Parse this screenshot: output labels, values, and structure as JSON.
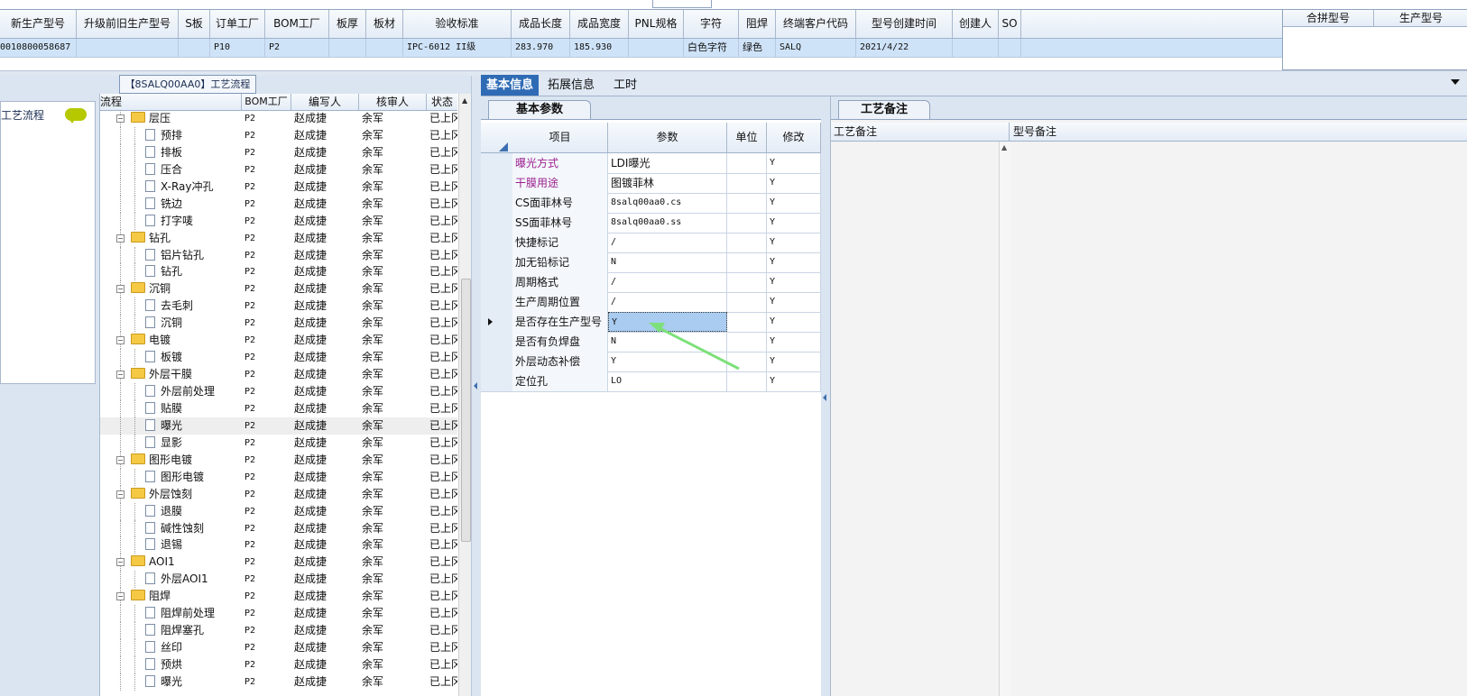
{
  "top_grid": {
    "columns": [
      "新生产型号",
      "升级前旧生产型号",
      "S板",
      "订单工厂",
      "BOM工厂",
      "板厚",
      "板材",
      "验收标准",
      "成品长度",
      "成品宽度",
      "PNL规格",
      "字符",
      "阻焊",
      "终端客户代码",
      "型号创建时间",
      "创建人",
      "SO"
    ],
    "row": {
      "新生产型号": "0010800058687",
      "订单工厂": "P10",
      "BOM工厂": "P2",
      "验收标准": "IPC-6012 II级",
      "成品长度": "283.970",
      "成品宽度": "185.930",
      "字符": "白色字符",
      "阻焊": "绿色",
      "终端客户代码": "SALQ",
      "型号创建时间": "2021/4/22"
    },
    "right_columns": [
      "合拼型号",
      "生产型号"
    ]
  },
  "left_panel": {
    "tab_title": "【8SALQ00AA0】工艺流程",
    "side_label": "工艺流程",
    "tree_columns": [
      "流程",
      "BOM工厂",
      "编写人",
      "核审人",
      "状态"
    ],
    "tree_rows": [
      {
        "level": 0,
        "name": "层压",
        "bom": "P2",
        "writer": "赵成捷",
        "reviewer": "余军",
        "status": "已上冈"
      },
      {
        "level": 1,
        "name": "预排",
        "bom": "P2",
        "writer": "赵成捷",
        "reviewer": "余军",
        "status": "已上冈"
      },
      {
        "level": 1,
        "name": "排板",
        "bom": "P2",
        "writer": "赵成捷",
        "reviewer": "余军",
        "status": "已上冈"
      },
      {
        "level": 1,
        "name": "压合",
        "bom": "P2",
        "writer": "赵成捷",
        "reviewer": "余军",
        "status": "已上冈"
      },
      {
        "level": 1,
        "name": "X-Ray冲孔",
        "bom": "P2",
        "writer": "赵成捷",
        "reviewer": "余军",
        "status": "已上冈"
      },
      {
        "level": 1,
        "name": "铣边",
        "bom": "P2",
        "writer": "赵成捷",
        "reviewer": "余军",
        "status": "已上冈"
      },
      {
        "level": 1,
        "name": "打字唛",
        "bom": "P2",
        "writer": "赵成捷",
        "reviewer": "余军",
        "status": "已上冈"
      },
      {
        "level": 0,
        "name": "钻孔",
        "bom": "P2",
        "writer": "赵成捷",
        "reviewer": "余军",
        "status": "已上冈"
      },
      {
        "level": 1,
        "name": "铝片钻孔",
        "bom": "P2",
        "writer": "赵成捷",
        "reviewer": "余军",
        "status": "已上冈"
      },
      {
        "level": 1,
        "name": "钻孔",
        "bom": "P2",
        "writer": "赵成捷",
        "reviewer": "余军",
        "status": "已上冈"
      },
      {
        "level": 0,
        "name": "沉铜",
        "bom": "P2",
        "writer": "赵成捷",
        "reviewer": "余军",
        "status": "已上冈"
      },
      {
        "level": 1,
        "name": "去毛刺",
        "bom": "P2",
        "writer": "赵成捷",
        "reviewer": "余军",
        "status": "已上冈"
      },
      {
        "level": 1,
        "name": "沉铜",
        "bom": "P2",
        "writer": "赵成捷",
        "reviewer": "余军",
        "status": "已上冈"
      },
      {
        "level": 0,
        "name": "电镀",
        "bom": "P2",
        "writer": "赵成捷",
        "reviewer": "余军",
        "status": "已上冈"
      },
      {
        "level": 1,
        "name": "板镀",
        "bom": "P2",
        "writer": "赵成捷",
        "reviewer": "余军",
        "status": "已上冈"
      },
      {
        "level": 0,
        "name": "外层干膜",
        "bom": "P2",
        "writer": "赵成捷",
        "reviewer": "余军",
        "status": "已上冈"
      },
      {
        "level": 1,
        "name": "外层前处理",
        "bom": "P2",
        "writer": "赵成捷",
        "reviewer": "余军",
        "status": "已上冈"
      },
      {
        "level": 1,
        "name": "贴膜",
        "bom": "P2",
        "writer": "赵成捷",
        "reviewer": "余军",
        "status": "已上冈"
      },
      {
        "level": 1,
        "name": "曝光",
        "bom": "P2",
        "writer": "赵成捷",
        "reviewer": "余军",
        "status": "已上冈",
        "highlight": true
      },
      {
        "level": 1,
        "name": "显影",
        "bom": "P2",
        "writer": "赵成捷",
        "reviewer": "余军",
        "status": "已上冈"
      },
      {
        "level": 0,
        "name": "图形电镀",
        "bom": "P2",
        "writer": "赵成捷",
        "reviewer": "余军",
        "status": "已上冈"
      },
      {
        "level": 1,
        "name": "图形电镀",
        "bom": "P2",
        "writer": "赵成捷",
        "reviewer": "余军",
        "status": "已上冈"
      },
      {
        "level": 0,
        "name": "外层蚀刻",
        "bom": "P2",
        "writer": "赵成捷",
        "reviewer": "余军",
        "status": "已上冈"
      },
      {
        "level": 1,
        "name": "退膜",
        "bom": "P2",
        "writer": "赵成捷",
        "reviewer": "余军",
        "status": "已上冈"
      },
      {
        "level": 1,
        "name": "碱性蚀刻",
        "bom": "P2",
        "writer": "赵成捷",
        "reviewer": "余军",
        "status": "已上冈"
      },
      {
        "level": 1,
        "name": "退锡",
        "bom": "P2",
        "writer": "赵成捷",
        "reviewer": "余军",
        "status": "已上冈"
      },
      {
        "level": 0,
        "name": "AOI1",
        "bom": "P2",
        "writer": "赵成捷",
        "reviewer": "余军",
        "status": "已上冈"
      },
      {
        "level": 1,
        "name": "外层AOI1",
        "bom": "P2",
        "writer": "赵成捷",
        "reviewer": "余军",
        "status": "已上冈"
      },
      {
        "level": 0,
        "name": "阻焊",
        "bom": "P2",
        "writer": "赵成捷",
        "reviewer": "余军",
        "status": "已上冈"
      },
      {
        "level": 1,
        "name": "阻焊前处理",
        "bom": "P2",
        "writer": "赵成捷",
        "reviewer": "余军",
        "status": "已上冈"
      },
      {
        "level": 1,
        "name": "阻焊塞孔",
        "bom": "P2",
        "writer": "赵成捷",
        "reviewer": "余军",
        "status": "已上冈"
      },
      {
        "level": 1,
        "name": "丝印",
        "bom": "P2",
        "writer": "赵成捷",
        "reviewer": "余军",
        "status": "已上冈"
      },
      {
        "level": 1,
        "name": "预烘",
        "bom": "P2",
        "writer": "赵成捷",
        "reviewer": "余军",
        "status": "已上冈"
      },
      {
        "level": 1,
        "name": "曝光",
        "bom": "P2",
        "writer": "赵成捷",
        "reviewer": "余军",
        "status": "已上冈"
      }
    ]
  },
  "main_tabs": [
    "基本信息",
    "拓展信息",
    "工时"
  ],
  "basic_params": {
    "subtab": "基本参数",
    "columns": [
      "项目",
      "参数",
      "单位",
      "修改"
    ],
    "rows": [
      {
        "item": "曝光方式",
        "value": "LDI曝光",
        "unit": "",
        "mod": "Y",
        "purple": true
      },
      {
        "item": "干膜用途",
        "value": "图镀菲林",
        "unit": "",
        "mod": "Y",
        "purple": true
      },
      {
        "item": "CS面菲林号",
        "value": "8salq00aa0.cs",
        "unit": "",
        "mod": "Y"
      },
      {
        "item": "SS面菲林号",
        "value": "8salq00aa0.ss",
        "unit": "",
        "mod": "Y"
      },
      {
        "item": "快捷标记",
        "value": "/",
        "unit": "",
        "mod": "Y"
      },
      {
        "item": "加无铅标记",
        "value": "N",
        "unit": "",
        "mod": "Y"
      },
      {
        "item": "周期格式",
        "value": "/",
        "unit": "",
        "mod": "Y"
      },
      {
        "item": "生产周期位置",
        "value": "/",
        "unit": "",
        "mod": "Y"
      },
      {
        "item": "是否存在生产型号",
        "value": "Y",
        "unit": "",
        "mod": "Y",
        "current": true
      },
      {
        "item": "是否有负焊盘",
        "value": "N",
        "unit": "",
        "mod": "Y"
      },
      {
        "item": "外层动态补偿",
        "value": "Y",
        "unit": "",
        "mod": "Y"
      },
      {
        "item": "定位孔",
        "value": "LO",
        "unit": "",
        "mod": "Y"
      }
    ]
  },
  "process_notes": {
    "subtab": "工艺备注",
    "columns": [
      "工艺备注",
      "型号备注"
    ]
  },
  "colors": {
    "tab_active": "#2f6bb5",
    "arrow": "#7ee07a",
    "purple_text": "#9b1f8f"
  }
}
